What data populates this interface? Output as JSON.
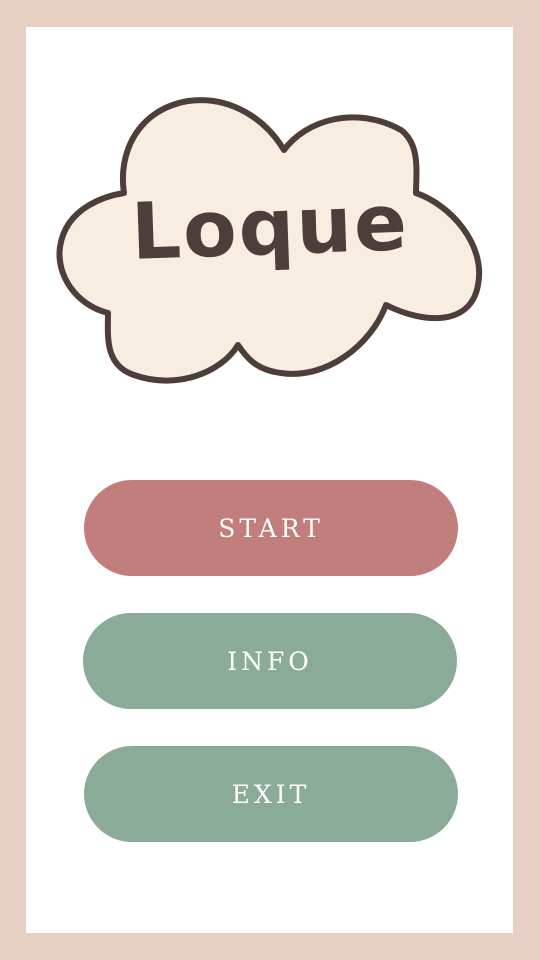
{
  "game": {
    "logo_text": "Loque"
  },
  "menu": {
    "start_label": "START",
    "info_label": "INFO",
    "exit_label": "EXIT"
  },
  "colors": {
    "border": "#e7d0c3",
    "panel": "#ffffff",
    "cloud_fill": "#f7ede0",
    "cloud_outline": "#4e3e3b",
    "start_button": "#c27e7d",
    "secondary_button": "#8bab99",
    "button_text": "#ffffff"
  }
}
